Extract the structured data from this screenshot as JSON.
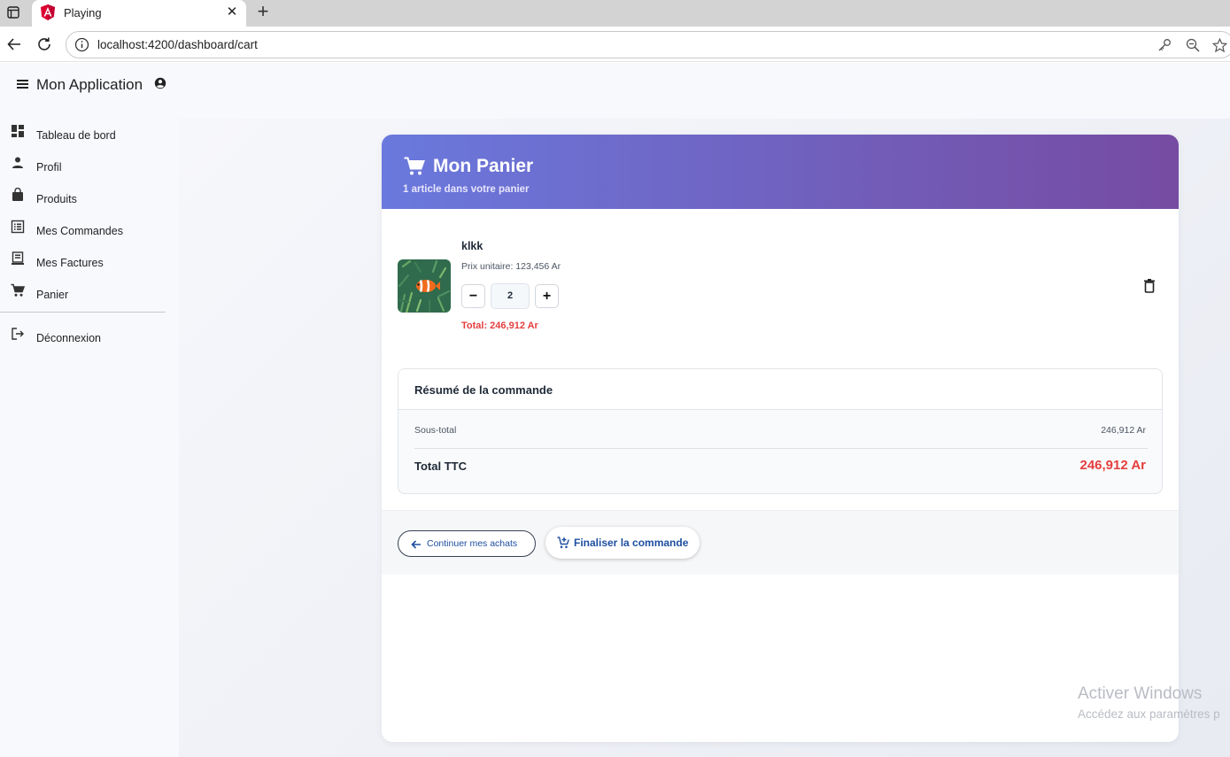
{
  "browser": {
    "tab_title": "Playing",
    "url": "localhost:4200/dashboard/cart",
    "favicon": "angular-icon"
  },
  "app": {
    "title": "Mon Application"
  },
  "sidebar": {
    "items": [
      {
        "label": "Tableau de bord",
        "icon": "dashboard-icon"
      },
      {
        "label": "Profil",
        "icon": "person-icon"
      },
      {
        "label": "Produits",
        "icon": "shopping-bag-icon"
      },
      {
        "label": "Mes Commandes",
        "icon": "list-alt-icon"
      },
      {
        "label": "Mes Factures",
        "icon": "receipt-icon"
      },
      {
        "label": "Panier",
        "icon": "cart-icon"
      }
    ],
    "logout": {
      "label": "Déconnexion",
      "icon": "logout-icon"
    }
  },
  "cart": {
    "title": "Mon Panier",
    "subtitle": "1 article dans votre panier",
    "header_gradient": [
      "#6a79dd",
      "#764ba2"
    ],
    "items": [
      {
        "name": "klkk",
        "unit_price": "Prix unitaire: 123,456 Ar",
        "quantity": "2",
        "decrement_label": "−",
        "increment_label": "+",
        "total": "Total: 246,912 Ar",
        "image": "clownfish-photo"
      }
    ],
    "summary": {
      "title": "Résumé de la commande",
      "subtotal_label": "Sous-total",
      "subtotal_value": "246,912 Ar",
      "total_label": "Total TTC",
      "total_value": "246,912 Ar"
    },
    "actions": {
      "continue_label": "Continuer mes achats",
      "finalize_label": "Finaliser la commande"
    }
  },
  "colors": {
    "accent_red": "#e53e3e",
    "link_blue": "#1e4fa0"
  },
  "watermark": {
    "title": "Activer Windows",
    "subtitle": "Accédez aux paramètres p"
  }
}
